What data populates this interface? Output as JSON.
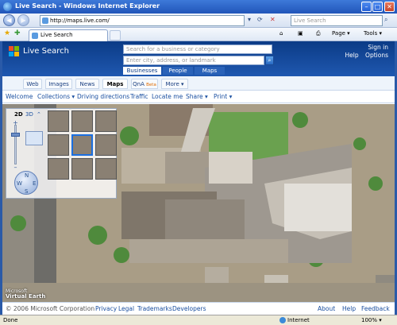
{
  "window": {
    "title": "Live Search - Windows Internet Explorer",
    "controls": {
      "minimize": "–",
      "maximize": "□",
      "close": "✕"
    }
  },
  "addressbar": {
    "url": "http://maps.live.com/",
    "search_placeholder": "Live Search",
    "icons": [
      "back-icon",
      "forward-icon",
      "refresh-icon",
      "stop-icon",
      "search-icon"
    ]
  },
  "tabbar": {
    "tab_title": "Live Search",
    "commands": {
      "page": "Page ▾",
      "tools": "Tools ▾"
    }
  },
  "header": {
    "brand": "Live Search",
    "links": {
      "sign_in": "Sign in",
      "help": "Help",
      "options": "Options"
    },
    "business_placeholder": "Search for a business or category",
    "location_placeholder": "Enter city, address, or landmark",
    "scopes": [
      "Businesses",
      "People",
      "Maps"
    ],
    "selected_scope": "Businesses"
  },
  "verticals": {
    "items": [
      "Web",
      "Images",
      "News",
      "Maps",
      "QnA",
      "More ▾"
    ],
    "beta_label": "Beta",
    "selected": "Maps"
  },
  "map_toolbar": {
    "items": [
      "Welcome",
      "Collections ▾",
      "Driving directions",
      "Traffic",
      "Locate me",
      "Share ▾",
      "Print ▾"
    ]
  },
  "map": {
    "modes": [
      "2D",
      "3D"
    ],
    "selected_mode": "2D",
    "zoom_in": "+",
    "zoom_out": "–",
    "compass": {
      "n": "N",
      "s": "S",
      "e": "E",
      "w": "W"
    },
    "logo_line1": "Microsoft",
    "logo_line2": "Virtual Earth"
  },
  "footer": {
    "copyright": "© 2006 Microsoft Corporation",
    "links": [
      "Privacy",
      "Legal",
      "Trademarks",
      "Developers"
    ],
    "right_links": [
      "About",
      "Help",
      "Feedback"
    ]
  },
  "statusbar": {
    "status": "Done",
    "zone": "Internet",
    "zoom": "100% ▾"
  },
  "colors": {
    "header_blue": "#0b3b86",
    "link_blue": "#1a4fa0",
    "beta_orange": "#e06b00",
    "selected_thumb": "#1b6fe0"
  }
}
